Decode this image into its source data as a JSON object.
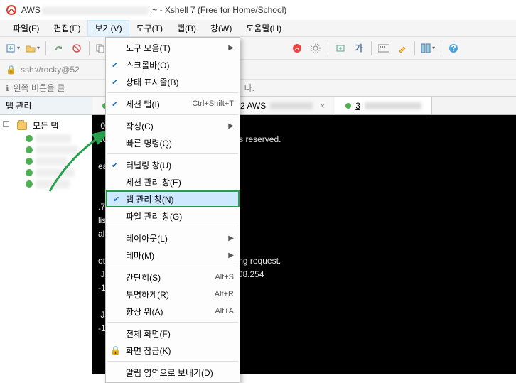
{
  "window": {
    "title_prefix": "AWS",
    "title_suffix": ":~ - Xshell 7 (Free for Home/School)"
  },
  "menubar": {
    "file": "파일(F)",
    "edit": "편집(E)",
    "view": "보기(V)",
    "tools": "도구(T)",
    "tab": "탭(B)",
    "window": "창(W)",
    "help": "도움말(H)"
  },
  "addr": {
    "text": "ssh://rocky@52"
  },
  "hint": {
    "text": "왼쪽 버튼을 클",
    "tail": "다."
  },
  "sidebar": {
    "title": "탭 관리",
    "root": "모든 탭"
  },
  "tabs": {
    "t2": "2 AWS",
    "t3": "3"
  },
  "terminal": {
    "l1": " 0144)",
    "l2": "20 NetSarang Computer, Inc. All rights reserved.",
    "l3": "",
    "l4": "earn how to use Xshell prompt.",
    "l5": "",
    "l6": "",
    "l7": ".78.160.251:22...",
    "l8": "lished.",
    "l9": "al shell, press 'Ctrl+Alt+]'.",
    "l10": "",
    "l11": "ote SSH server rejected X11 forwarding request.",
    "l12": " Jan 26 16:21:24 2024 from 122.43.208.254",
    "l13": "-11-71 ~]$ su -",
    "l14": "",
    "l15": " Jan 26 16:21:24 UTC 2024 on pts/1",
    "l16": "-11-71 ~]# "
  },
  "menu": {
    "toolbars": {
      "label": "도구 모음(T)"
    },
    "scrollbar": {
      "label": "스크롤바(O)"
    },
    "statusbar": {
      "label": "상태 표시줄(B)"
    },
    "sessiontab": {
      "label": "세션 탭(I)",
      "accel": "Ctrl+Shift+T"
    },
    "compose": {
      "label": "작성(C)"
    },
    "quickcmd": {
      "label": "빠른 명령(Q)"
    },
    "tunnel": {
      "label": "터널링 창(U)"
    },
    "sessmgr": {
      "label": "세션 관리 창(E)"
    },
    "tabmgr": {
      "label": "탭 관리 창(N)"
    },
    "filemgr": {
      "label": "파일 관리 창(G)"
    },
    "layout": {
      "label": "레이아웃(L)"
    },
    "theme": {
      "label": "테마(M)"
    },
    "simple": {
      "label": "간단히(S)",
      "accel": "Alt+S"
    },
    "transparent": {
      "label": "투명하게(R)",
      "accel": "Alt+R"
    },
    "ontop": {
      "label": "항상 위(A)",
      "accel": "Alt+A"
    },
    "fullscreen": {
      "label": "전체 화면(F)"
    },
    "lock": {
      "label": "화면 잠금(K)"
    },
    "notify": {
      "label": "알림 영역으로 보내기(D)"
    }
  }
}
